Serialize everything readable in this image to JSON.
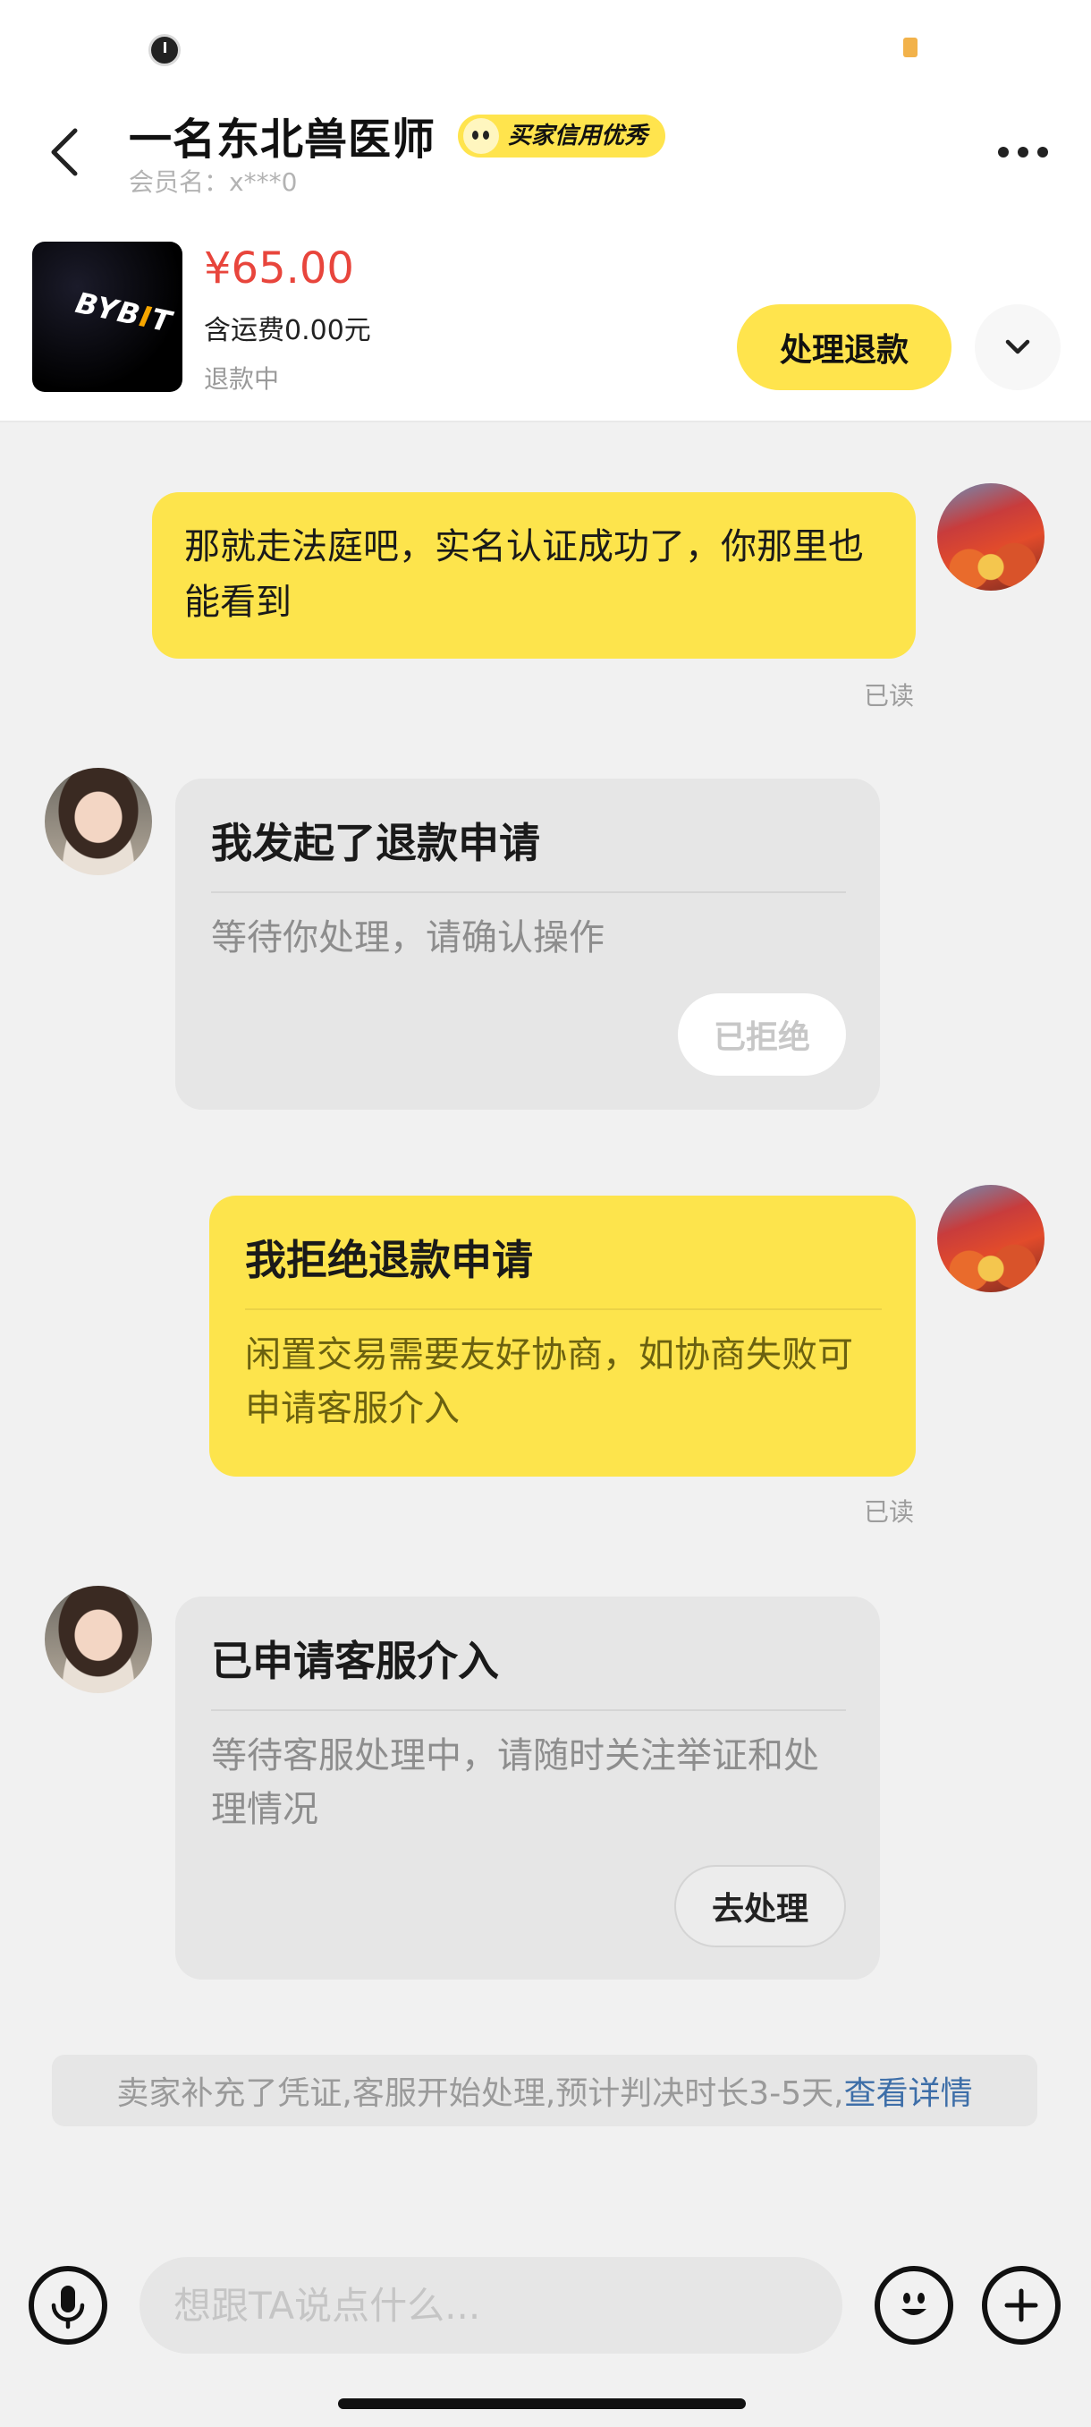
{
  "header": {
    "nickname": "一名东北兽医师",
    "credit_badge": "买家信用优秀",
    "member_line": "会员名：x***0"
  },
  "product": {
    "thumb_logo_prefix": "BYB",
    "thumb_logo_accent": "I",
    "thumb_logo_suffix": "T",
    "price": "¥65.00",
    "shipping": "含运费0.00元",
    "status": "退款中",
    "action_label": "处理退款"
  },
  "messages": {
    "m1_text": "那就走法庭吧，实名认证成功了，你那里也能看到",
    "m1_read": "已读",
    "m2_title": "我发起了退款申请",
    "m2_body": "等待你处理，请确认操作",
    "m2_button": "已拒绝",
    "m3_title": "我拒绝退款申请",
    "m3_body": "闲置交易需要友好协商，如协商失败可申请客服介入",
    "m3_read": "已读",
    "m4_title": "已申请客服介入",
    "m4_body": "等待客服处理中，请随时关注举证和处理情况",
    "m4_button": "去处理"
  },
  "notice": {
    "text": "卖家补充了凭证,客服开始处理,预计判决时长3-5天,",
    "link": "查看详情"
  },
  "input": {
    "placeholder": "想跟TA说点什么..."
  },
  "icons": {
    "back": "chevron-left-icon",
    "more": "more-dots-icon",
    "expand": "chevron-down-icon",
    "voice": "microphone-icon",
    "emoji": "emoji-icon",
    "add": "plus-icon"
  },
  "colors": {
    "accent_yellow": "#fde44c",
    "price_red": "#e8453c",
    "link_blue": "#3d6ea8"
  }
}
